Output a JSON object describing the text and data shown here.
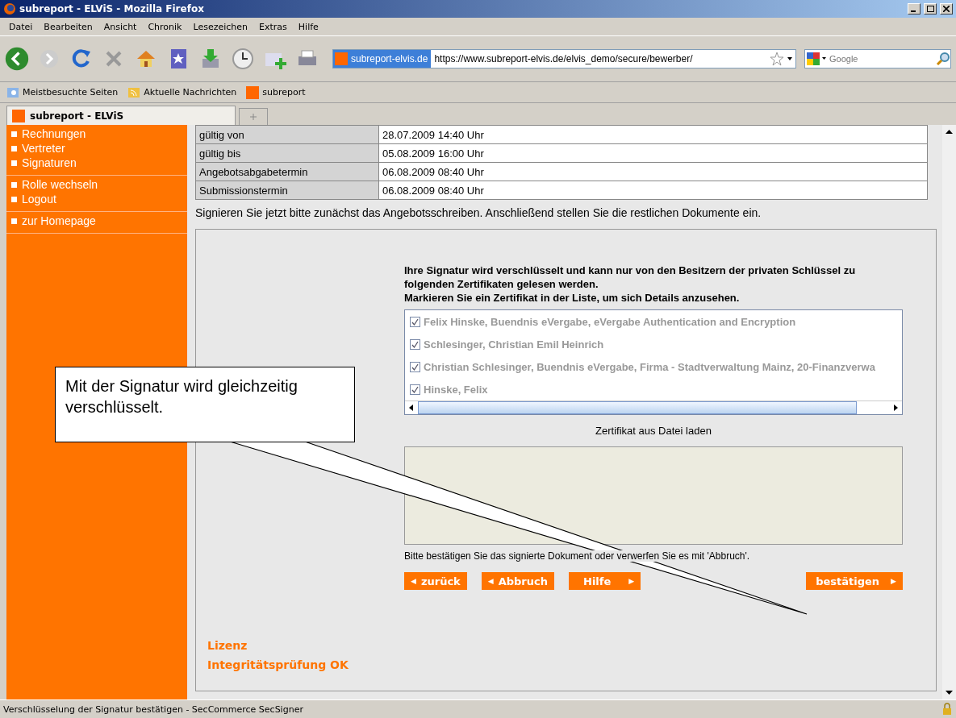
{
  "window": {
    "title": "subreport - ELViS - Mozilla Firefox"
  },
  "menu": [
    "Datei",
    "Bearbeiten",
    "Ansicht",
    "Chronik",
    "Lesezeichen",
    "Extras",
    "Hilfe"
  ],
  "url_bar": {
    "site": "subreport-elvis.de",
    "url": "https://www.subreport-elvis.de/elvis_demo/secure/bewerber/"
  },
  "search": {
    "placeholder": "Google"
  },
  "bookmarks": [
    "Meistbesuchte Seiten",
    "Aktuelle Nachrichten",
    "subreport"
  ],
  "tabs": [
    {
      "label": "subreport - ELViS",
      "selected": true
    }
  ],
  "sidebar": {
    "groups": [
      [
        "Rechnungen",
        "Vertreter",
        "Signaturen"
      ],
      [
        "Rolle wechseln",
        "Logout"
      ],
      [
        "zur Homepage"
      ]
    ]
  },
  "details": [
    {
      "label": "gültig von",
      "value": "28.07.2009 14:40 Uhr"
    },
    {
      "label": "gültig bis",
      "value": "05.08.2009 16:00 Uhr"
    },
    {
      "label": "Angebotsabgabetermin",
      "value": "06.08.2009 08:40 Uhr"
    },
    {
      "label": "Submissionstermin",
      "value": "06.08.2009 08:40 Uhr"
    }
  ],
  "instruction": "Signieren Sie jetzt bitte zunächst das Angebotsschreiben. Anschließend stellen Sie die restlichen Dokumente ein.",
  "signer": {
    "intro": "Ihre Signatur wird verschlüsselt und kann nur von den Besitzern der privaten Schlüssel zu folgenden Zertifikaten gelesen werden.",
    "hint": "Markieren Sie ein Zertifikat in der Liste, um sich Details anzusehen.",
    "certificates": [
      {
        "name": "Felix Hinske, Buendnis eVergabe, eVergabe Authentication and Encryption",
        "checked": true
      },
      {
        "name": "Schlesinger, Christian Emil Heinrich",
        "checked": true
      },
      {
        "name": "Christian Schlesinger, Buendnis eVergabe, Firma - Stadtverwaltung Mainz, 20-Finanzverwa",
        "checked": true
      },
      {
        "name": "Hinske, Felix",
        "checked": true
      }
    ],
    "load_label": "Zertifikat aus Datei laden",
    "confirm_text": "Bitte bestätigen Sie das signierte Dokument oder verwerfen Sie es mit 'Abbruch'.",
    "links": [
      "Lizenz",
      "Integritätsprüfung OK"
    ],
    "nav_buttons": [
      {
        "label": "zurück",
        "arrow_before": "◀"
      },
      {
        "label": "Abbruch",
        "arrow_before": "◀"
      },
      {
        "label": "Hilfe",
        "arrow_after": "▶"
      }
    ],
    "confirm_button": {
      "label": "bestätigen",
      "arrow_after": "▶"
    }
  },
  "callout": "Mit der Signatur wird gleichzeitig verschlüsselt.",
  "status_bar": "Verschlüsselung der Signatur bestätigen - SecCommerce SecSigner"
}
